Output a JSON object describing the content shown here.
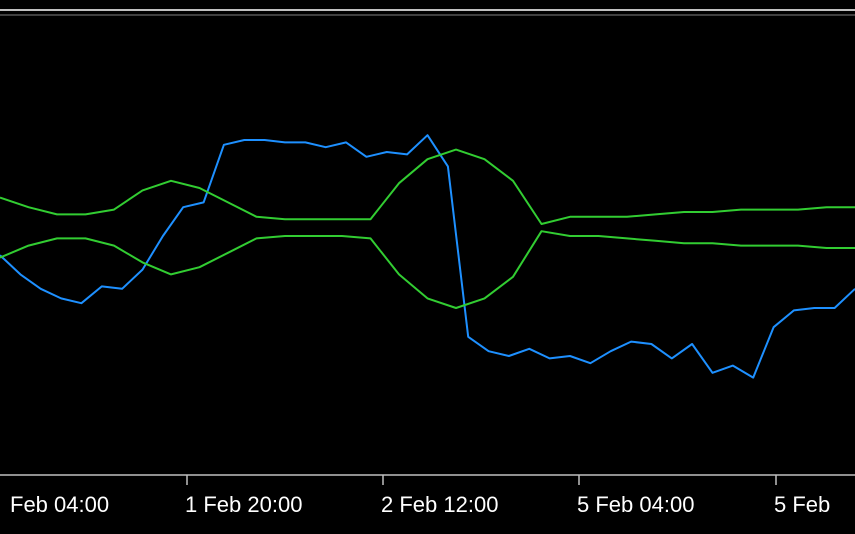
{
  "chart_data": {
    "type": "line",
    "x_tick_labels": [
      "Feb 04:00",
      "1 Feb 20:00",
      "2 Feb 12:00",
      "5 Feb 04:00",
      "5 Feb"
    ],
    "grid": false,
    "legend": "none",
    "series": [
      {
        "color": "#1e90ff",
        "values": [
          0.52,
          0.44,
          0.38,
          0.34,
          0.32,
          0.39,
          0.38,
          0.46,
          0.6,
          0.72,
          0.74,
          0.98,
          1.0,
          1.0,
          0.99,
          0.99,
          0.97,
          0.99,
          0.93,
          0.95,
          0.94,
          1.02,
          0.89,
          0.18,
          0.12,
          0.1,
          0.13,
          0.09,
          0.1,
          0.07,
          0.12,
          0.16,
          0.15,
          0.09,
          0.15,
          0.03,
          0.06,
          0.01,
          0.22,
          0.29,
          0.3,
          0.3,
          0.38
        ]
      },
      {
        "color": "#32cd32",
        "values": [
          0.76,
          0.72,
          0.69,
          0.69,
          0.71,
          0.79,
          0.83,
          0.8,
          0.74,
          0.68,
          0.67,
          0.67,
          0.67,
          0.67,
          0.82,
          0.92,
          0.96,
          0.92,
          0.83,
          0.65,
          0.68,
          0.68,
          0.68,
          0.69,
          0.7,
          0.7,
          0.71,
          0.71,
          0.71,
          0.72,
          0.72
        ]
      },
      {
        "color": "#32cd32",
        "values": [
          0.51,
          0.56,
          0.59,
          0.59,
          0.56,
          0.49,
          0.44,
          0.47,
          0.53,
          0.59,
          0.6,
          0.6,
          0.6,
          0.59,
          0.44,
          0.34,
          0.3,
          0.34,
          0.43,
          0.62,
          0.6,
          0.6,
          0.59,
          0.58,
          0.57,
          0.57,
          0.56,
          0.56,
          0.56,
          0.55,
          0.55
        ]
      }
    ]
  }
}
